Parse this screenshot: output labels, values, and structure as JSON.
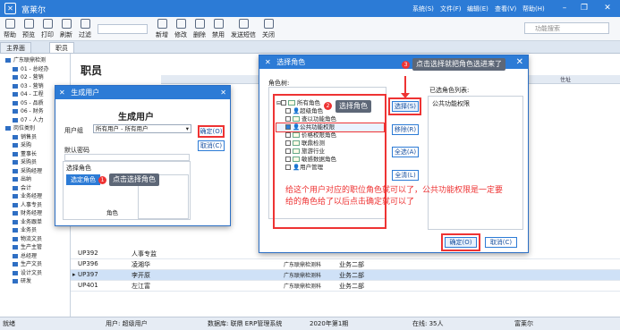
{
  "app": {
    "title": "富莱尔",
    "menus": [
      "系统(S)",
      "文件(F)",
      "编辑(E)",
      "查看(V)",
      "帮助(H)"
    ]
  },
  "toolbar": {
    "left": [
      "帮助",
      "预览",
      "打印",
      "刷新",
      "过滤"
    ],
    "right": [
      "新增",
      "修改",
      "删除",
      "禁用",
      "发送短信",
      "关闭"
    ]
  },
  "search": {
    "placeholder": "功能搜索"
  },
  "tabs": [
    "主界面",
    "职员"
  ],
  "tree": [
    "广东联鼎检测",
    "01 - 总经办",
    "02 - 营销",
    "03 - 营销",
    "04 - 工程",
    "05 - 品质",
    "06 - 财务",
    "07 - 人力",
    "岗位类别",
    "销售员",
    "采购",
    "董事长",
    "采购员",
    "采购经理",
    "出纳",
    "会计",
    "业务经理",
    "人事专员",
    "财务经理",
    "业务跟单",
    "业务员",
    "物流文员",
    "生产主管",
    "总经理",
    "生产文员",
    "设计文员",
    "研发"
  ],
  "page": {
    "heading": "职员"
  },
  "grid": {
    "headers": [
      "住址"
    ],
    "rows": [
      {
        "code": "UP392",
        "name": "人事专监",
        "company": "",
        "dept": ""
      },
      {
        "code": "UP396",
        "name": "凌湘华",
        "company": "广东联鼎检测科",
        "dept": "业务二部"
      },
      {
        "code": "UP397",
        "name": "李开原",
        "company": "广东联鼎检测科",
        "dept": "业务二部"
      },
      {
        "code": "UP401",
        "name": "左江富",
        "company": "广东联鼎检测科",
        "dept": "业务二部"
      }
    ]
  },
  "status": {
    "state": "就绪",
    "user": "用户: 超级用户",
    "db": "数据库: 联鼎 ERP管理系统",
    "period": "2020年第1期",
    "online": "在线: 35人",
    "company": "富莱尔"
  },
  "create_user": {
    "title": "生成用户",
    "heading": "生成用户",
    "group_label": "用户组",
    "group_value": "所有用户 - 所有用户",
    "default_pwd_label": "默认密码",
    "role_label": "选择角色",
    "role_btn": "选定角色",
    "role_caption": "角色",
    "ok": "确定(O)",
    "cancel": "取消(C)",
    "callout": "点击选择角色",
    "num": "1"
  },
  "select_role": {
    "title": "选择角色",
    "tree_label": "角色树:",
    "selected_label": "已选角色列表:",
    "items": [
      "所有角色",
      "超级角色",
      "查以功能角色",
      "公共功能权限",
      "价格权限角色",
      "联鼎检测",
      "旅游行业",
      "敏感数据角色",
      "用户管理"
    ],
    "checked": "公共功能权限",
    "selected": [
      "公共功能权限"
    ],
    "btn_select": "选择(S)",
    "btn_remove": "移除(R)",
    "btn_all_select": "全选(A)",
    "btn_all_clear": "全清(L)",
    "ok": "确定(O)",
    "cancel": "取消(C)",
    "callout2": "选择角色",
    "num2": "2",
    "callout3": "点击选择就把角色选进来了",
    "num3": "3",
    "note": "给这个用户对应的职位角色就可以了，公共功能权限是一定要给的角色给了以后点击确定就可以了"
  }
}
